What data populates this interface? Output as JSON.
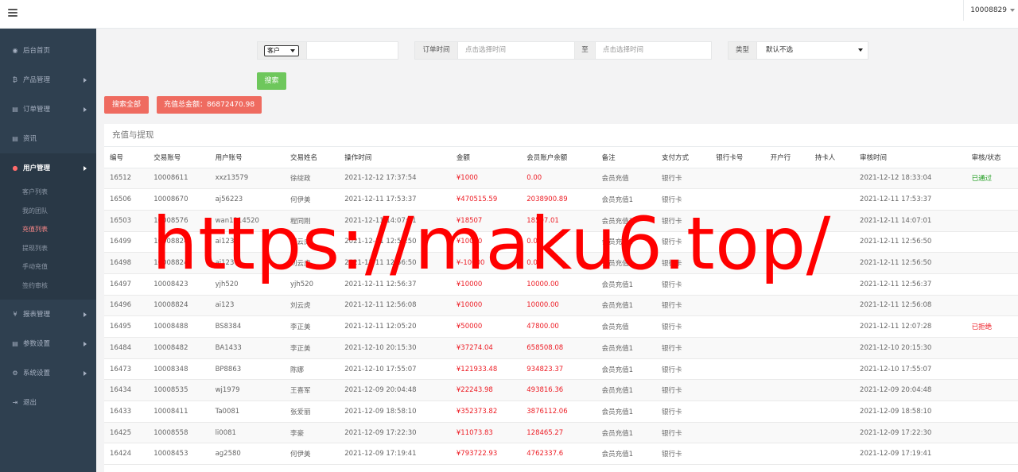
{
  "header": {
    "user": "10008829"
  },
  "sidebar": {
    "items": [
      {
        "label": "后台首页",
        "icon": "◉",
        "icon_name": "dashboard-icon",
        "has_arrow": false
      },
      {
        "label": "产品管理",
        "icon": "₿",
        "icon_name": "bitcoin-icon",
        "has_arrow": true
      },
      {
        "label": "订单管理",
        "icon": "▤",
        "icon_name": "copy-icon",
        "has_arrow": true
      },
      {
        "label": "资讯",
        "icon": "▤",
        "icon_name": "copy-icon",
        "has_arrow": false
      },
      {
        "label": "用户管理",
        "icon": "●",
        "icon_name": "user-icon",
        "has_arrow": true,
        "active": true
      },
      {
        "label": "报表管理",
        "icon": "¥",
        "icon_name": "yen-icon",
        "has_arrow": true
      },
      {
        "label": "参数设置",
        "icon": "▤",
        "icon_name": "copy-icon",
        "has_arrow": true
      },
      {
        "label": "系统设置",
        "icon": "⚙",
        "icon_name": "gear-icon",
        "has_arrow": true
      },
      {
        "label": "退出",
        "icon": "⇥",
        "icon_name": "sign-out-icon",
        "has_arrow": false
      }
    ],
    "sub_items": [
      {
        "label": "客户列表"
      },
      {
        "label": "我的团队"
      },
      {
        "label": "充值列表",
        "active": true
      },
      {
        "label": "提现列表"
      },
      {
        "label": "手动充值"
      },
      {
        "label": "签约审核"
      }
    ]
  },
  "filters": {
    "customer_select": "客户",
    "order_time_label": "订单时间",
    "time_placeholder_start": "点击选择时间",
    "to_label": "至",
    "time_placeholder_end": "点击选择时间",
    "type_label": "类型",
    "type_value": "默认不选",
    "search_button": "搜索"
  },
  "actions": {
    "search_all": "搜索全部",
    "recharge_total": "充值总金额：86872470.98"
  },
  "panel": {
    "title": "充值与提现"
  },
  "table": {
    "columns": [
      "编号",
      "交易账号",
      "用户账号",
      "交易姓名",
      "操作时间",
      "金额",
      "会员账户余额",
      "备注",
      "支付方式",
      "银行卡号",
      "开户行",
      "持卡人",
      "审核时间",
      "审核/状态"
    ],
    "rows": [
      [
        "16512",
        "10008611",
        "xxz13579",
        "徐绽政",
        "2021-12-12 17:37:54",
        "¥1000",
        "0.00",
        "会员充值",
        "银行卡",
        "",
        "",
        "",
        "2021-12-12 18:33:04",
        "已通过"
      ],
      [
        "16506",
        "10008670",
        "aj56223",
        "何伊美",
        "2021-12-11 17:53:37",
        "¥470515.59",
        "2038900.89",
        "会员充值1",
        "银行卡",
        "",
        "",
        "",
        "2021-12-11 17:53:37",
        ""
      ],
      [
        "16503",
        "10008576",
        "wan1314520",
        "程同刚",
        "2021-12-11 14:07:01",
        "¥18507",
        "18507.01",
        "会员充值1",
        "银行卡",
        "",
        "",
        "",
        "2021-12-11 14:07:01",
        ""
      ],
      [
        "16499",
        "10008824",
        "ai123",
        "刘云虎",
        "2021-12-11 12:56:50",
        "¥10000",
        "0.00",
        "会员充值1",
        "银行卡",
        "",
        "",
        "",
        "2021-12-11 12:56:50",
        ""
      ],
      [
        "16498",
        "10008824",
        "ai123",
        "刘云虎",
        "2021-12-11 12:56:50",
        "¥-10000",
        "0.00",
        "会员充值",
        "银行卡",
        "",
        "",
        "",
        "2021-12-11 12:56:50",
        ""
      ],
      [
        "16497",
        "10008423",
        "yjh520",
        "yjh520",
        "2021-12-11 12:56:37",
        "¥10000",
        "10000.00",
        "会员充值1",
        "银行卡",
        "",
        "",
        "",
        "2021-12-11 12:56:37",
        ""
      ],
      [
        "16496",
        "10008824",
        "ai123",
        "刘云虎",
        "2021-12-11 12:56:08",
        "¥10000",
        "10000.00",
        "会员充值1",
        "银行卡",
        "",
        "",
        "",
        "2021-12-11 12:56:08",
        ""
      ],
      [
        "16495",
        "10008488",
        "BS8384",
        "李正美",
        "2021-12-11 12:05:20",
        "¥50000",
        "47800.00",
        "会员充值",
        "银行卡",
        "",
        "",
        "",
        "2021-12-11 12:07:28",
        "已拒绝"
      ],
      [
        "16484",
        "10008482",
        "BA1433",
        "李正美",
        "2021-12-10 20:15:30",
        "¥37274.04",
        "658508.08",
        "会员充值1",
        "银行卡",
        "",
        "",
        "",
        "2021-12-10 20:15:30",
        ""
      ],
      [
        "16473",
        "10008348",
        "BP8863",
        "陈娜",
        "2021-12-10 17:55:07",
        "¥121933.48",
        "934823.37",
        "会员充值1",
        "银行卡",
        "",
        "",
        "",
        "2021-12-10 17:55:07",
        ""
      ],
      [
        "16434",
        "10008535",
        "wj1979",
        "王喜军",
        "2021-12-09 20:04:48",
        "¥22243.98",
        "493816.36",
        "会员充值1",
        "银行卡",
        "",
        "",
        "",
        "2021-12-09 20:04:48",
        ""
      ],
      [
        "16433",
        "10008411",
        "Ta0081",
        "张爱丽",
        "2021-12-09 18:58:10",
        "¥352373.82",
        "3876112.06",
        "会员充值1",
        "银行卡",
        "",
        "",
        "",
        "2021-12-09 18:58:10",
        ""
      ],
      [
        "16425",
        "10008558",
        "li0081",
        "李豪",
        "2021-12-09 17:22:30",
        "¥11073.83",
        "128465.27",
        "会员充值1",
        "银行卡",
        "",
        "",
        "",
        "2021-12-09 17:22:30",
        ""
      ],
      [
        "16424",
        "10008453",
        "ag2580",
        "何伊美",
        "2021-12-09 17:19:41",
        "¥793722.93",
        "4762337.6",
        "会员充值1",
        "银行卡",
        "",
        "",
        "",
        "2021-12-09 17:19:41",
        ""
      ]
    ]
  },
  "watermark": "https://maku6.top/",
  "colors": {
    "sidebar": "#2f4050",
    "accent_red": "#ef6b60",
    "accent_green": "#6ec75c",
    "amount_red": "#ed1c24",
    "status_pass": "#1a9b1a"
  }
}
